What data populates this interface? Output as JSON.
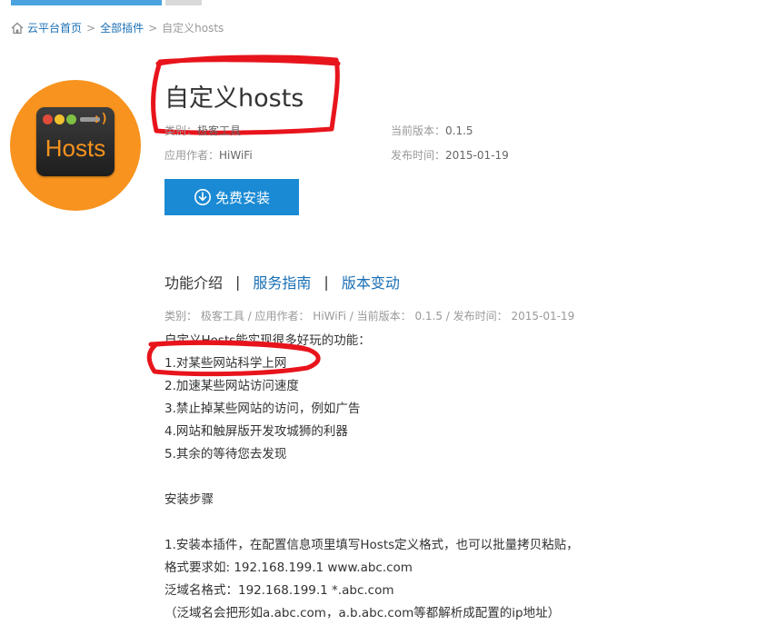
{
  "breadcrumb": {
    "home": "云平台首页",
    "sep": ">",
    "all_plugins": "全部插件",
    "current": "自定义hosts"
  },
  "plugin": {
    "title": "自定义hosts",
    "logo_text": "Hosts",
    "logo_smile": ":)",
    "category_label": "类别：",
    "category_value": "极客工具",
    "author_label": "应用作者：",
    "author_value": "HiWiFi",
    "version_label": "当前版本：",
    "version_value": "0.1.5",
    "release_label": "发布时间：",
    "release_value": "2015-01-19",
    "install_label": "免费安装"
  },
  "tabs": [
    {
      "label": "功能介绍"
    },
    {
      "label": "服务指南"
    },
    {
      "label": "版本变动"
    }
  ],
  "tab_separator": "|",
  "subline": "类别： 极客工具 / 应用作者： HiWiFi / 当前版本： 0.1.5 / 发布时间： 2015-01-19",
  "content": [
    "自定义Hosts能实现很多好玩的功能：",
    "1.对某些网站科学上网",
    "2.加速某些网站访问速度",
    "3.禁止掉某些网站的访问，例如广告",
    "4.网站和触屏版开发攻城狮的利器",
    "5.其余的等待您去发现",
    "",
    "安装步骤",
    "",
    "1.安装本插件，在配置信息项里填写Hosts定义格式，也可以批量拷贝粘贴，",
    "格式要求如:   192.168.199.1    www.abc.com",
    "泛域名格式：192.168.199.1    *.abc.com",
    "（泛域名会把形如a.abc.com，a.b.abc.com等都解析成配置的ip地址）"
  ],
  "colors": {
    "link": "#1a6fb5",
    "button": "#1a8ad4",
    "logo_orange": "#f7931e",
    "annotation_red": "#e8141c"
  }
}
